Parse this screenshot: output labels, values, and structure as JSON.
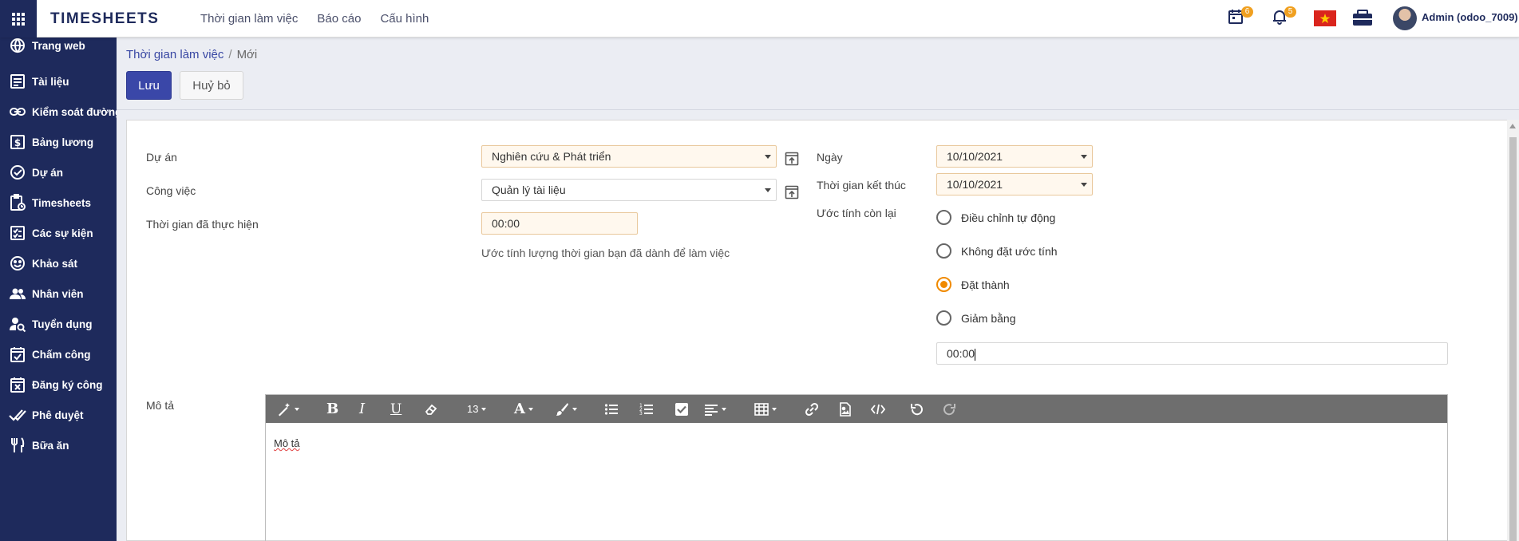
{
  "app": {
    "title": "TIMESHEETS"
  },
  "top_menu": [
    {
      "label": "Thời gian làm việc"
    },
    {
      "label": "Báo cáo"
    },
    {
      "label": "Cấu hình"
    }
  ],
  "systray": {
    "activity_count": "6",
    "message_count": "5",
    "user_name": "Admin (odoo_7009)"
  },
  "sidebar": {
    "items": [
      {
        "label": "Trang web",
        "icon": "globe-icon"
      },
      {
        "label": "Tài liệu",
        "icon": "document-icon"
      },
      {
        "label": "Kiểm soát đường",
        "icon": "link-icon"
      },
      {
        "label": "Bảng lương",
        "icon": "money-icon"
      },
      {
        "label": "Dự án",
        "icon": "check-circle-icon"
      },
      {
        "label": "Timesheets",
        "icon": "clipboard-clock-icon"
      },
      {
        "label": "Các sự kiện",
        "icon": "checklist-icon"
      },
      {
        "label": "Khảo sát",
        "icon": "smile-icon"
      },
      {
        "label": "Nhân viên",
        "icon": "people-icon"
      },
      {
        "label": "Tuyển dụng",
        "icon": "person-search-icon"
      },
      {
        "label": "Chấm công",
        "icon": "calendar-check-icon"
      },
      {
        "label": "Đăng ký công",
        "icon": "calendar-x-icon"
      },
      {
        "label": "Phê duyệt",
        "icon": "double-check-icon"
      },
      {
        "label": "Bữa ăn",
        "icon": "fork-knife-icon"
      }
    ]
  },
  "breadcrumb": {
    "parent": "Thời gian làm việc",
    "separator": "/",
    "current": "Mới"
  },
  "buttons": {
    "save": "Lưu",
    "discard": "Huỷ bỏ"
  },
  "form": {
    "project": {
      "label": "Dự án",
      "value": "Nghiên cứu & Phát triển"
    },
    "task": {
      "label": "Công việc",
      "value": "Quản lý tài liệu"
    },
    "duration": {
      "label": "Thời gian đã thực hiện",
      "value": "00:00",
      "help": "Ước tính lượng thời gian bạn đã dành để làm việc"
    },
    "date": {
      "label": "Ngày",
      "value": "10/10/2021"
    },
    "end_date": {
      "label": "Thời gian kết thúc",
      "value": "10/10/2021"
    },
    "remaining": {
      "label": "Ước tính còn lại",
      "options": [
        {
          "label": "Điều chỉnh tự động",
          "selected": false
        },
        {
          "label": "Không đặt ước tính",
          "selected": false
        },
        {
          "label": "Đặt thành",
          "selected": true
        },
        {
          "label": "Giảm bằng",
          "selected": false
        }
      ],
      "value": "00:00"
    },
    "description": {
      "label": "Mô tả",
      "placeholder": "Mô tả"
    }
  },
  "editor_toolbar": {
    "font_size": "13"
  },
  "colors": {
    "brand": "#1e2a5c",
    "primary_button": "#3a47a8",
    "radio_accent": "#f08a00",
    "badge": "#f0a020"
  }
}
